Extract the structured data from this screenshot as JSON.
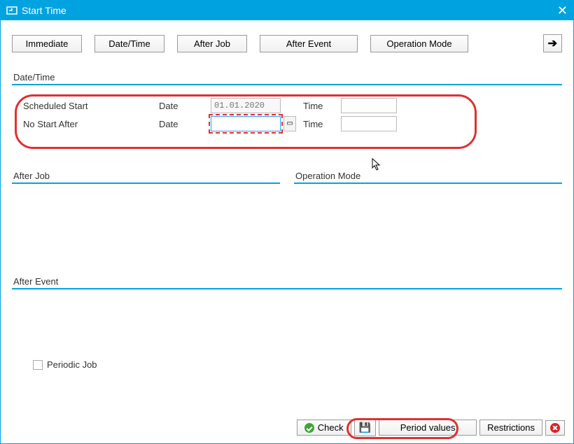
{
  "window": {
    "title": "Start Time"
  },
  "buttons": {
    "immediate": "Immediate",
    "datetime": "Date/Time",
    "afterjob": "After Job",
    "afterevent": "After Event",
    "opmode": "Operation Mode"
  },
  "sections": {
    "datetime": "Date/Time",
    "afterjob": "After Job",
    "opmode": "Operation Mode",
    "afterevent": "After Event"
  },
  "form": {
    "scheduled_start": "Scheduled Start",
    "no_start_after": "No Start After",
    "date_label": "Date",
    "time_label": "Time",
    "scheduled_date": "01.01.2020",
    "scheduled_time": "",
    "nostart_date": "",
    "nostart_time": ""
  },
  "periodic_label": "Periodic Job",
  "bottom": {
    "check": "Check",
    "period_values": "Period values",
    "restrictions": "Restrictions"
  }
}
